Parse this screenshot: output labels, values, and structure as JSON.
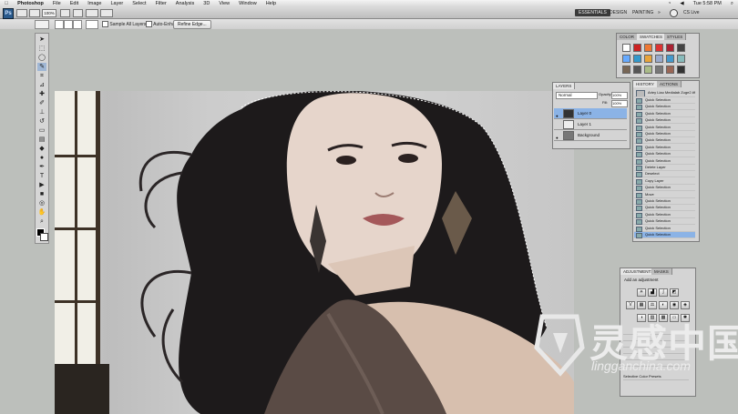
{
  "menubar": {
    "apple": "",
    "app": "Photoshop",
    "items": [
      "File",
      "Edit",
      "Image",
      "Layer",
      "Select",
      "Filter",
      "Analysis",
      "3D",
      "View",
      "Window",
      "Help"
    ],
    "clock": "Tue 5:58 PM"
  },
  "appbar": {
    "logo": "Ps",
    "zoom": "100%",
    "workspaces": [
      "ESSENTIALS",
      "DESIGN",
      "PAINTING"
    ],
    "more": "»",
    "search_hint": "CS Live"
  },
  "options": {
    "sample_all_layers": "Sample All Layers",
    "auto_enhance": "Auto-Enhance",
    "refine_edge": "Refine Edge..."
  },
  "panels": {
    "swatches": {
      "tabs": [
        "COLOR",
        "SWATCHES",
        "STYLES"
      ]
    },
    "history": {
      "tabs": [
        "HISTORY",
        "ACTIONS"
      ],
      "snapshot": "Ariey Liao Medialab Zuge2.tif",
      "items": [
        "Quick Selection",
        "Quick Selection",
        "Quick Selection",
        "Quick Selection",
        "Quick Selection",
        "Quick Selection",
        "Quick Selection",
        "Quick Selection",
        "Quick Selection",
        "Quick Selection",
        "Delete Layer",
        "Deselect",
        "Copy Layer",
        "Quick Selection",
        "Move",
        "Quick Selection",
        "Quick Selection",
        "Quick Selection",
        "Quick Selection",
        "Quick Selection",
        "Quick Selection"
      ]
    },
    "layers": {
      "tabs": [
        "LAYERS"
      ],
      "blend_mode": "Normal",
      "opacity_label": "Opacity:",
      "opacity": "100%",
      "fill_label": "Fill:",
      "fill": "100%",
      "rows": [
        {
          "name": "Layer 0",
          "selected": true
        },
        {
          "name": "Layer 1",
          "selected": false
        },
        {
          "name": "Background",
          "selected": false
        }
      ]
    },
    "adjustments": {
      "tabs": [
        "ADJUSTMENTS",
        "MASKS"
      ],
      "title": "Add an adjustment",
      "preset_list_label": "Selective Color Presets"
    }
  },
  "watermark": {
    "brand": "灵感中国",
    "url": "lingganchina.com"
  },
  "colors": {
    "workspace": "#bcbfbb",
    "panel": "#d4d4d4",
    "selection": "#8bb3e6"
  }
}
